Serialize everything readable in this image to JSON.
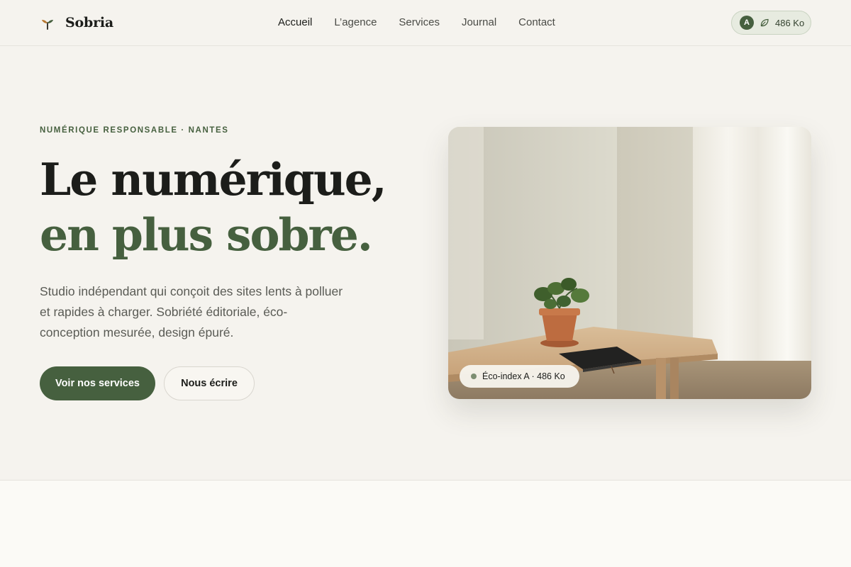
{
  "brand": {
    "name": "Sobria",
    "logo": "seedling-icon"
  },
  "nav": {
    "items": [
      {
        "label": "Accueil",
        "active": true
      },
      {
        "label": "L’agence",
        "active": false
      },
      {
        "label": "Services",
        "active": false
      },
      {
        "label": "Journal",
        "active": false
      },
      {
        "label": "Contact",
        "active": false
      }
    ]
  },
  "eco_badge": {
    "grade": "A",
    "icon": "leaf-icon",
    "size": "486 Ko"
  },
  "hero": {
    "kicker": "NUMÉRIQUE RESPONSABLE · NANTES",
    "headline_line1": "Le numérique,",
    "headline_line2": "en plus sobre.",
    "lede": "Studio indépendant qui conçoit des sites lents à polluer et rapides à charger. Sobriété éditoriale, éco-conception mesurée, design épuré.",
    "primary_cta": "Voir nos services",
    "secondary_cta": "Nous écrire",
    "image_badge": "Éco-index A · 486 Ko"
  },
  "colors": {
    "background": "#f5f3ee",
    "accent": "#46603f",
    "text": "#1c1d1a",
    "muted": "#5a5b55"
  }
}
